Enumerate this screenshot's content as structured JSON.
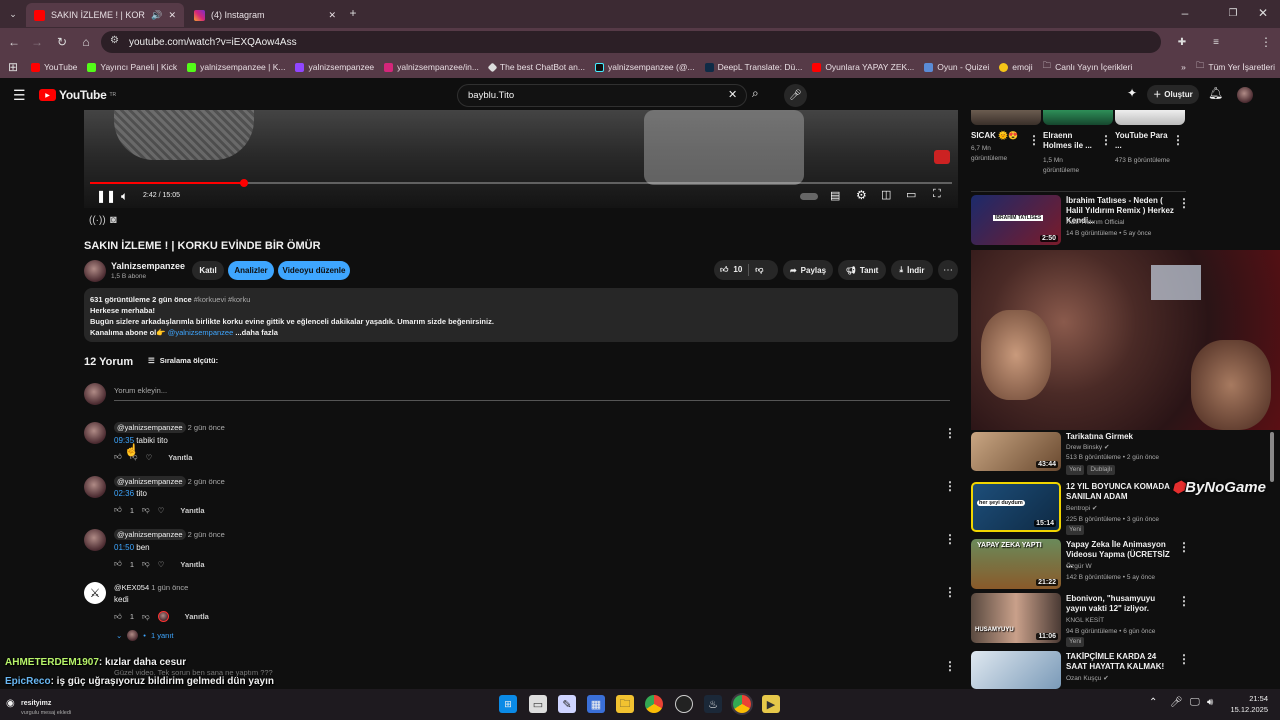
{
  "browser": {
    "tabs": [
      {
        "label": "SAKIN İZLEME ! | KORKU EV"
      },
      {
        "label": "(4) Instagram"
      }
    ],
    "url": "youtube.com/watch?v=iEXQAow4Ass",
    "bookmarks": [
      "YouTube",
      "Yayıncı Paneli | Kick",
      "yalnizsempanzee | K...",
      "yalnizsempanzee",
      "yalnizsempanzee/in...",
      "The best ChatBot an...",
      "yalnizsempanzee (@...",
      "DeepL Translate: Dü...",
      "Oyunlara YAPAY ZEK...",
      "Oyun - Quizei",
      "emoji",
      "Canlı Yayın İçerikleri"
    ],
    "bookmarks_right": "Tüm Yer İşaretleri"
  },
  "youtube": {
    "logo": "YouTube",
    "logo_sup": "TR",
    "search_value": "bayblu.Tito",
    "create_label": "Oluştur"
  },
  "player": {
    "time": "2:42 / 15:05",
    "progress_fraction": 0.179
  },
  "video": {
    "title": "SAKIN İZLEME ! | KORKU EVİNDE BİR ÖMÜR",
    "channel": "Yalnizsempanzee",
    "subs": "1,5 B abone",
    "join": "Katıl",
    "analytics": "Analizler",
    "edit": "Videoyu düzenle",
    "likes": "10",
    "share": "Paylaş",
    "promote": "Tanıt",
    "download": "İndir"
  },
  "description": {
    "stats": "631 görüntüleme  2 gün önce",
    "tags": "#korkuevi #korku",
    "line1": "Herkese merhaba!",
    "line2": "Bugün sizlere arkadaşlarımla birlikte korku evine gittik ve eğlenceli dakikalar yaşadık. Umarım sizde beğenirsiniz.",
    "line3": "Kanalıma abone ol👉",
    "handle": "@yalnizsempanzee",
    "more": "...daha fazla"
  },
  "comments": {
    "count": "12 Yorum",
    "sort": "Sıralama ölçütü:",
    "add_placeholder": "Yorum ekleyin...",
    "reply": "Yanıtla",
    "items": [
      {
        "author": "@yalnizsempanzee",
        "time": "2 gün önce",
        "ts": "09:35",
        "text": "tabiki tito",
        "likes": ""
      },
      {
        "author": "@yalnizsempanzee",
        "time": "2 gün önce",
        "ts": "02:36",
        "text": "tito",
        "likes": "1"
      },
      {
        "author": "@yalnizsempanzee",
        "time": "2 gün önce",
        "ts": "01:50",
        "text": "ben",
        "likes": "1"
      },
      {
        "author": "@KEX054",
        "time": "1 gün önce",
        "ts": "",
        "text": "kedi",
        "likes": "1"
      }
    ],
    "replies_toggle": "1 yanıt",
    "partial_text": "Güzel video. Tek sorun ben sana ne yaptım ???"
  },
  "sidebar": {
    "shorts": [
      {
        "title": "SICAK 🌞😍",
        "meta": "6,7 Mn görüntüleme"
      },
      {
        "title": "Elraenn Holmes ile ...",
        "meta": "1,5 Mn görüntüleme"
      },
      {
        "title": "YouTube Para ...",
        "meta": "473 B görüntüleme"
      }
    ],
    "videos": [
      {
        "title": "İbrahim Tatlıses - Neden ( Halil Yıldırım Remix ) Herkez Kendi...",
        "channel": "Halil Yıldırım Official",
        "meta": "14 B görüntüleme • 5 ay önce",
        "dur": "2:50",
        "badges": []
      },
      {
        "title": "Tarikatına Girmek",
        "channel": "Drew Binsky",
        "meta": "513 B görüntüleme • 2 gün önce",
        "dur": "43:44",
        "badges": [
          "Yeni",
          "Dublajlı"
        ]
      },
      {
        "title": "12 YIL BOYUNCA KOMADA SANILAN ADAM",
        "channel": "Bentropi",
        "meta": "225 B görüntüleme • 3 gün önce",
        "dur": "15:14",
        "badges": [
          "Yeni"
        ]
      },
      {
        "title": "Yapay Zeka İle Animasyon Videosu Yapma (ÜCRETSİZ ...",
        "channel": "Özgür W",
        "meta": "142 B görüntüleme • 5 ay önce",
        "dur": "21:22",
        "badges": []
      },
      {
        "title": "Ebonivon, \"husamyuyu yayın vakti 12\" izliyor.",
        "channel": "KNGL KESİT",
        "meta": "94 B görüntüleme • 6 gün önce",
        "dur": "11:06",
        "badges": [
          "Yeni"
        ]
      },
      {
        "title": "TAKİPÇİMLE KARDA 24 SAAT HAYATTA KALMAK!",
        "channel": "Ozan Kuşçu",
        "meta": "",
        "dur": "",
        "badges": []
      }
    ],
    "thumb_text": {
      "v1": "İBRAHİM TATLISES",
      "v3": "her şeyi duydum",
      "v4": "YAPAY ZEKA YAPTI",
      "v5": "HUSAMYUYU"
    }
  },
  "overlay": {
    "brand": "ByNoGame",
    "chat": [
      {
        "user": "AHMETERDEM1907",
        "msg": ": kızlar daha cesur"
      },
      {
        "user": "EpicReco",
        "msg": ": iş güç uğraşıyoruz bildirim gelmedi dün yayın"
      }
    ]
  },
  "taskbar": {
    "notif_title": "resityimz",
    "notif_sub": "vurgulu mesaj ekledi",
    "time": "21:54",
    "date": "15.12.2025"
  },
  "colors": {
    "accent_blue": "#3ea6ff",
    "red": "#ff0000",
    "tab_bg": "#563a47"
  }
}
